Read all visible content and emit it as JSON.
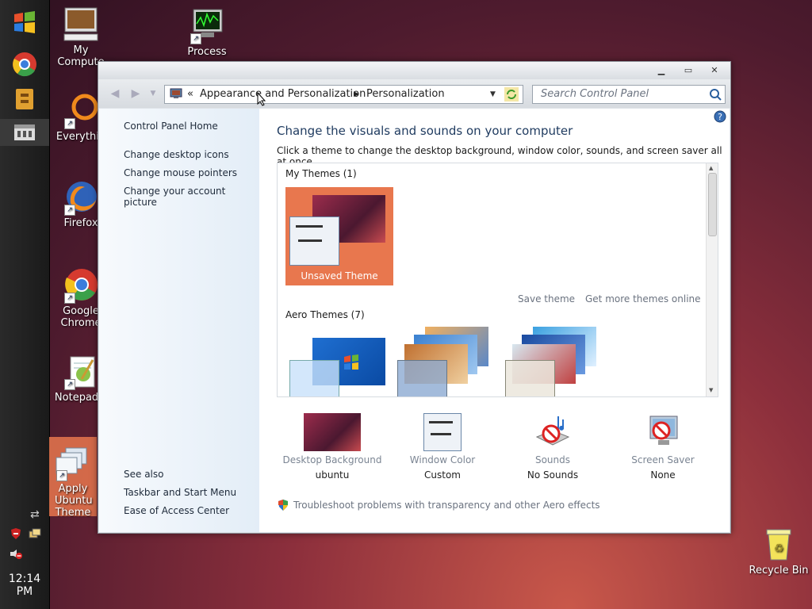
{
  "taskbar": {
    "clock": "12:14 PM"
  },
  "desktop": {
    "icons": [
      {
        "label": "My Compute"
      },
      {
        "label": "Process"
      },
      {
        "label": "Everythin"
      },
      {
        "label": "Firefox"
      },
      {
        "label": "Google Chrome"
      },
      {
        "label": "Notepad+"
      },
      {
        "label": "Apply Ubuntu Theme"
      },
      {
        "label": "Recycle Bin"
      }
    ]
  },
  "window": {
    "breadcrumb": {
      "prefix": "«",
      "parent": "Appearance and Personalization",
      "current": "Personalization"
    },
    "search_placeholder": "Search Control Panel",
    "left": {
      "home": "Control Panel Home",
      "links": [
        "Change desktop icons",
        "Change mouse pointers",
        "Change your account picture"
      ],
      "see_also": "See also",
      "see_also_links": [
        "Taskbar and Start Menu",
        "Ease of Access Center"
      ]
    },
    "main": {
      "heading": "Change the visuals and sounds on your computer",
      "subheading": "Click a theme to change the desktop background, window color, sounds, and screen saver all at once.",
      "my_themes_label": "My Themes (1)",
      "unsaved_theme_label": "Unsaved Theme",
      "save_theme": "Save theme",
      "get_more": "Get more themes online",
      "aero_themes_label": "Aero Themes (7)",
      "bottom": [
        {
          "label": "Desktop Background",
          "value": "ubuntu"
        },
        {
          "label": "Window Color",
          "value": "Custom"
        },
        {
          "label": "Sounds",
          "value": "No Sounds"
        },
        {
          "label": "Screen Saver",
          "value": "None"
        }
      ],
      "troubleshoot": "Troubleshoot problems with transparency and other Aero effects"
    }
  },
  "colors": {
    "selected_theme": "#e8774e",
    "heading": "#1e3a5f",
    "accent": "#3f8fd2"
  }
}
